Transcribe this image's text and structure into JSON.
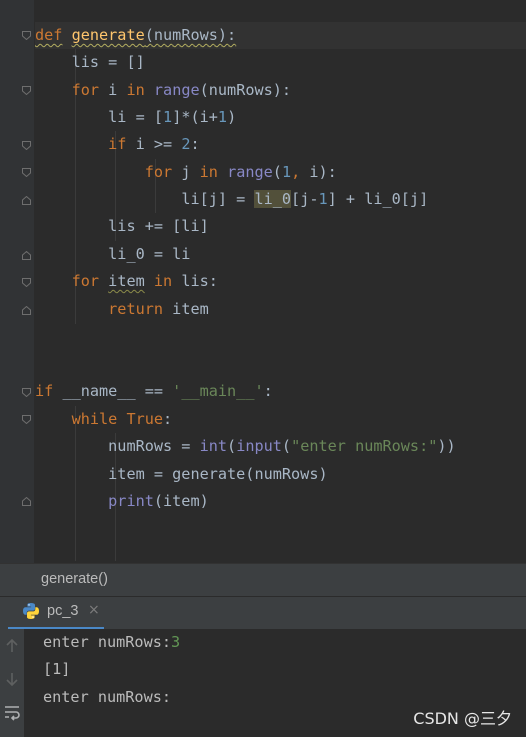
{
  "code": {
    "l1_def": "def",
    "l1_fn": "generate",
    "l1_params": "(numRows):",
    "l2": "lis = []",
    "l3_for": "for",
    "l3_var": " i ",
    "l3_in": "in",
    "l3_range": "range",
    "l3_tail": "(numRows):",
    "l4_a": "li = [",
    "l4_num1": "1",
    "l4_b": "]*(i+",
    "l4_num2": "1",
    "l4_c": ")",
    "l5_if": "if",
    "l5_a": " i >= ",
    "l5_num": "2",
    "l5_b": ":",
    "l6_for": "for",
    "l6_var": " j ",
    "l6_in": "in",
    "l6_range": "range",
    "l6_a": "(",
    "l6_num": "1",
    "l6_comma": ",",
    "l6_b": " i):",
    "l7_a": "li[j] = ",
    "l7_hl": "li_0",
    "l7_b": "[j-",
    "l7_num": "1",
    "l7_c": "] + li_0[j]",
    "l8": "lis += [li]",
    "l9": "li_0 = li",
    "l10_for": "for",
    "l10_item": "item",
    "l10_in": "in",
    "l10_tail": " lis:",
    "l11_return": "return",
    "l11_tail": " item",
    "l12_if": "if",
    "l12_a": " __name__ == ",
    "l12_str": "'__main__'",
    "l12_b": ":",
    "l13_while": "while",
    "l13_true": "True",
    "l13_b": ":",
    "l14_a": "numRows = ",
    "l14_int": "int",
    "l14_b": "(",
    "l14_input": "input",
    "l14_c": "(",
    "l14_str": "\"enter numRows:\"",
    "l14_d": "))",
    "l15": "item = generate(numRows)",
    "l16_print": "print",
    "l16_tail": "(item)"
  },
  "breadcrumb": {
    "text": "generate()"
  },
  "run_tab": {
    "name": "pc_3",
    "close": "×"
  },
  "console": {
    "line1_prompt": "enter numRows:",
    "line1_input": "3",
    "line2": "[1]",
    "line3": "enter numRows:"
  },
  "watermark": "CSDN @三夕",
  "icons": {
    "fold": "fold-icon",
    "python": "python-icon",
    "up": "arrow-up-icon",
    "down": "arrow-down-icon",
    "wrap": "soft-wrap-icon"
  },
  "colors": {
    "background": "#2b2b2b",
    "keyword": "#cc7832",
    "function": "#ffc66d",
    "number": "#6897bb",
    "string": "#6a8759",
    "builtin": "#8888c6",
    "text": "#a9b7c6",
    "console_input": "#629755"
  }
}
